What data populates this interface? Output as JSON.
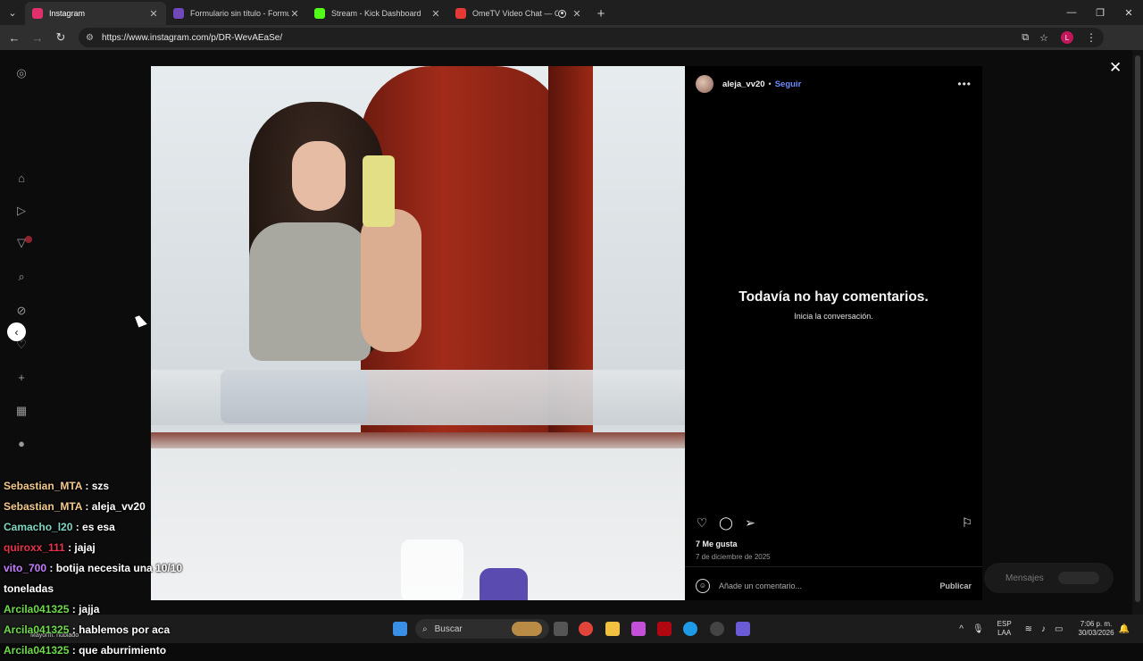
{
  "browser": {
    "tabs": [
      {
        "title": "Instagram",
        "color": "#e1306c",
        "active": true
      },
      {
        "title": "Formulario sin título - Formular",
        "color": "#7248b9",
        "active": false
      },
      {
        "title": "Stream - Kick Dashboard",
        "color": "#53fc18",
        "active": false
      },
      {
        "title": "OmeTV Video Chat — Ome",
        "color": "#e53935",
        "active": false
      }
    ],
    "url": "https://www.instagram.com/p/DR-WevAEaSe/",
    "profile_initial": "L"
  },
  "post": {
    "username": "aleja_vv20",
    "separator": "•",
    "follow_label": "Seguir",
    "empty_title": "Todavía no hay comentarios.",
    "empty_subtitle": "Inicia la conversación.",
    "likes": "7 Me gusta",
    "date": "7 de diciembre de 2025",
    "comment_placeholder": "Añade un comentario...",
    "publish_label": "Publicar"
  },
  "messages_pill": {
    "label": "Mensajes"
  },
  "chat": [
    {
      "user": "Sebastian_MTA",
      "color": "#f3c98b",
      "text": ": szs"
    },
    {
      "user": "Sebastian_MTA",
      "color": "#f3c98b",
      "text": ": aleja_vv20"
    },
    {
      "user": "Camacho_l20",
      "color": "#7fd6c2",
      "text": ": es esa"
    },
    {
      "user": "quiroxx_111",
      "color": "#e8334a",
      "text": ": jajaj"
    },
    {
      "user": "vito_700",
      "color": "#c77dff",
      "text": ": botija necesita una 10/10"
    },
    {
      "user": "",
      "color": "#ffffff",
      "text": "toneladas"
    },
    {
      "user": "Arcila041325",
      "color": "#6edc4a",
      "text": ": jajja"
    },
    {
      "user": "Arcila041325",
      "color": "#6edc4a",
      "text": ": hablemos por aca"
    },
    {
      "user": "Arcila041325",
      "color": "#6edc4a",
      "text": ": que aburrimiento"
    }
  ],
  "taskbar": {
    "weather": "Mayorm. nublado",
    "search_placeholder": "Buscar",
    "lang_top": "ESP",
    "lang_bottom": "LAA",
    "time": "7:06 p. m.",
    "date": "30/03/2026"
  },
  "icons": [
    "instagram-icon",
    "home-icon",
    "reels-icon",
    "explore-icon",
    "search-icon",
    "compass-icon",
    "heart-icon",
    "create-icon",
    "dashboard-icon",
    "profile-icon",
    "close-icon",
    "more-icon",
    "comment-icon",
    "share-icon",
    "bookmark-icon",
    "emoji-icon"
  ]
}
